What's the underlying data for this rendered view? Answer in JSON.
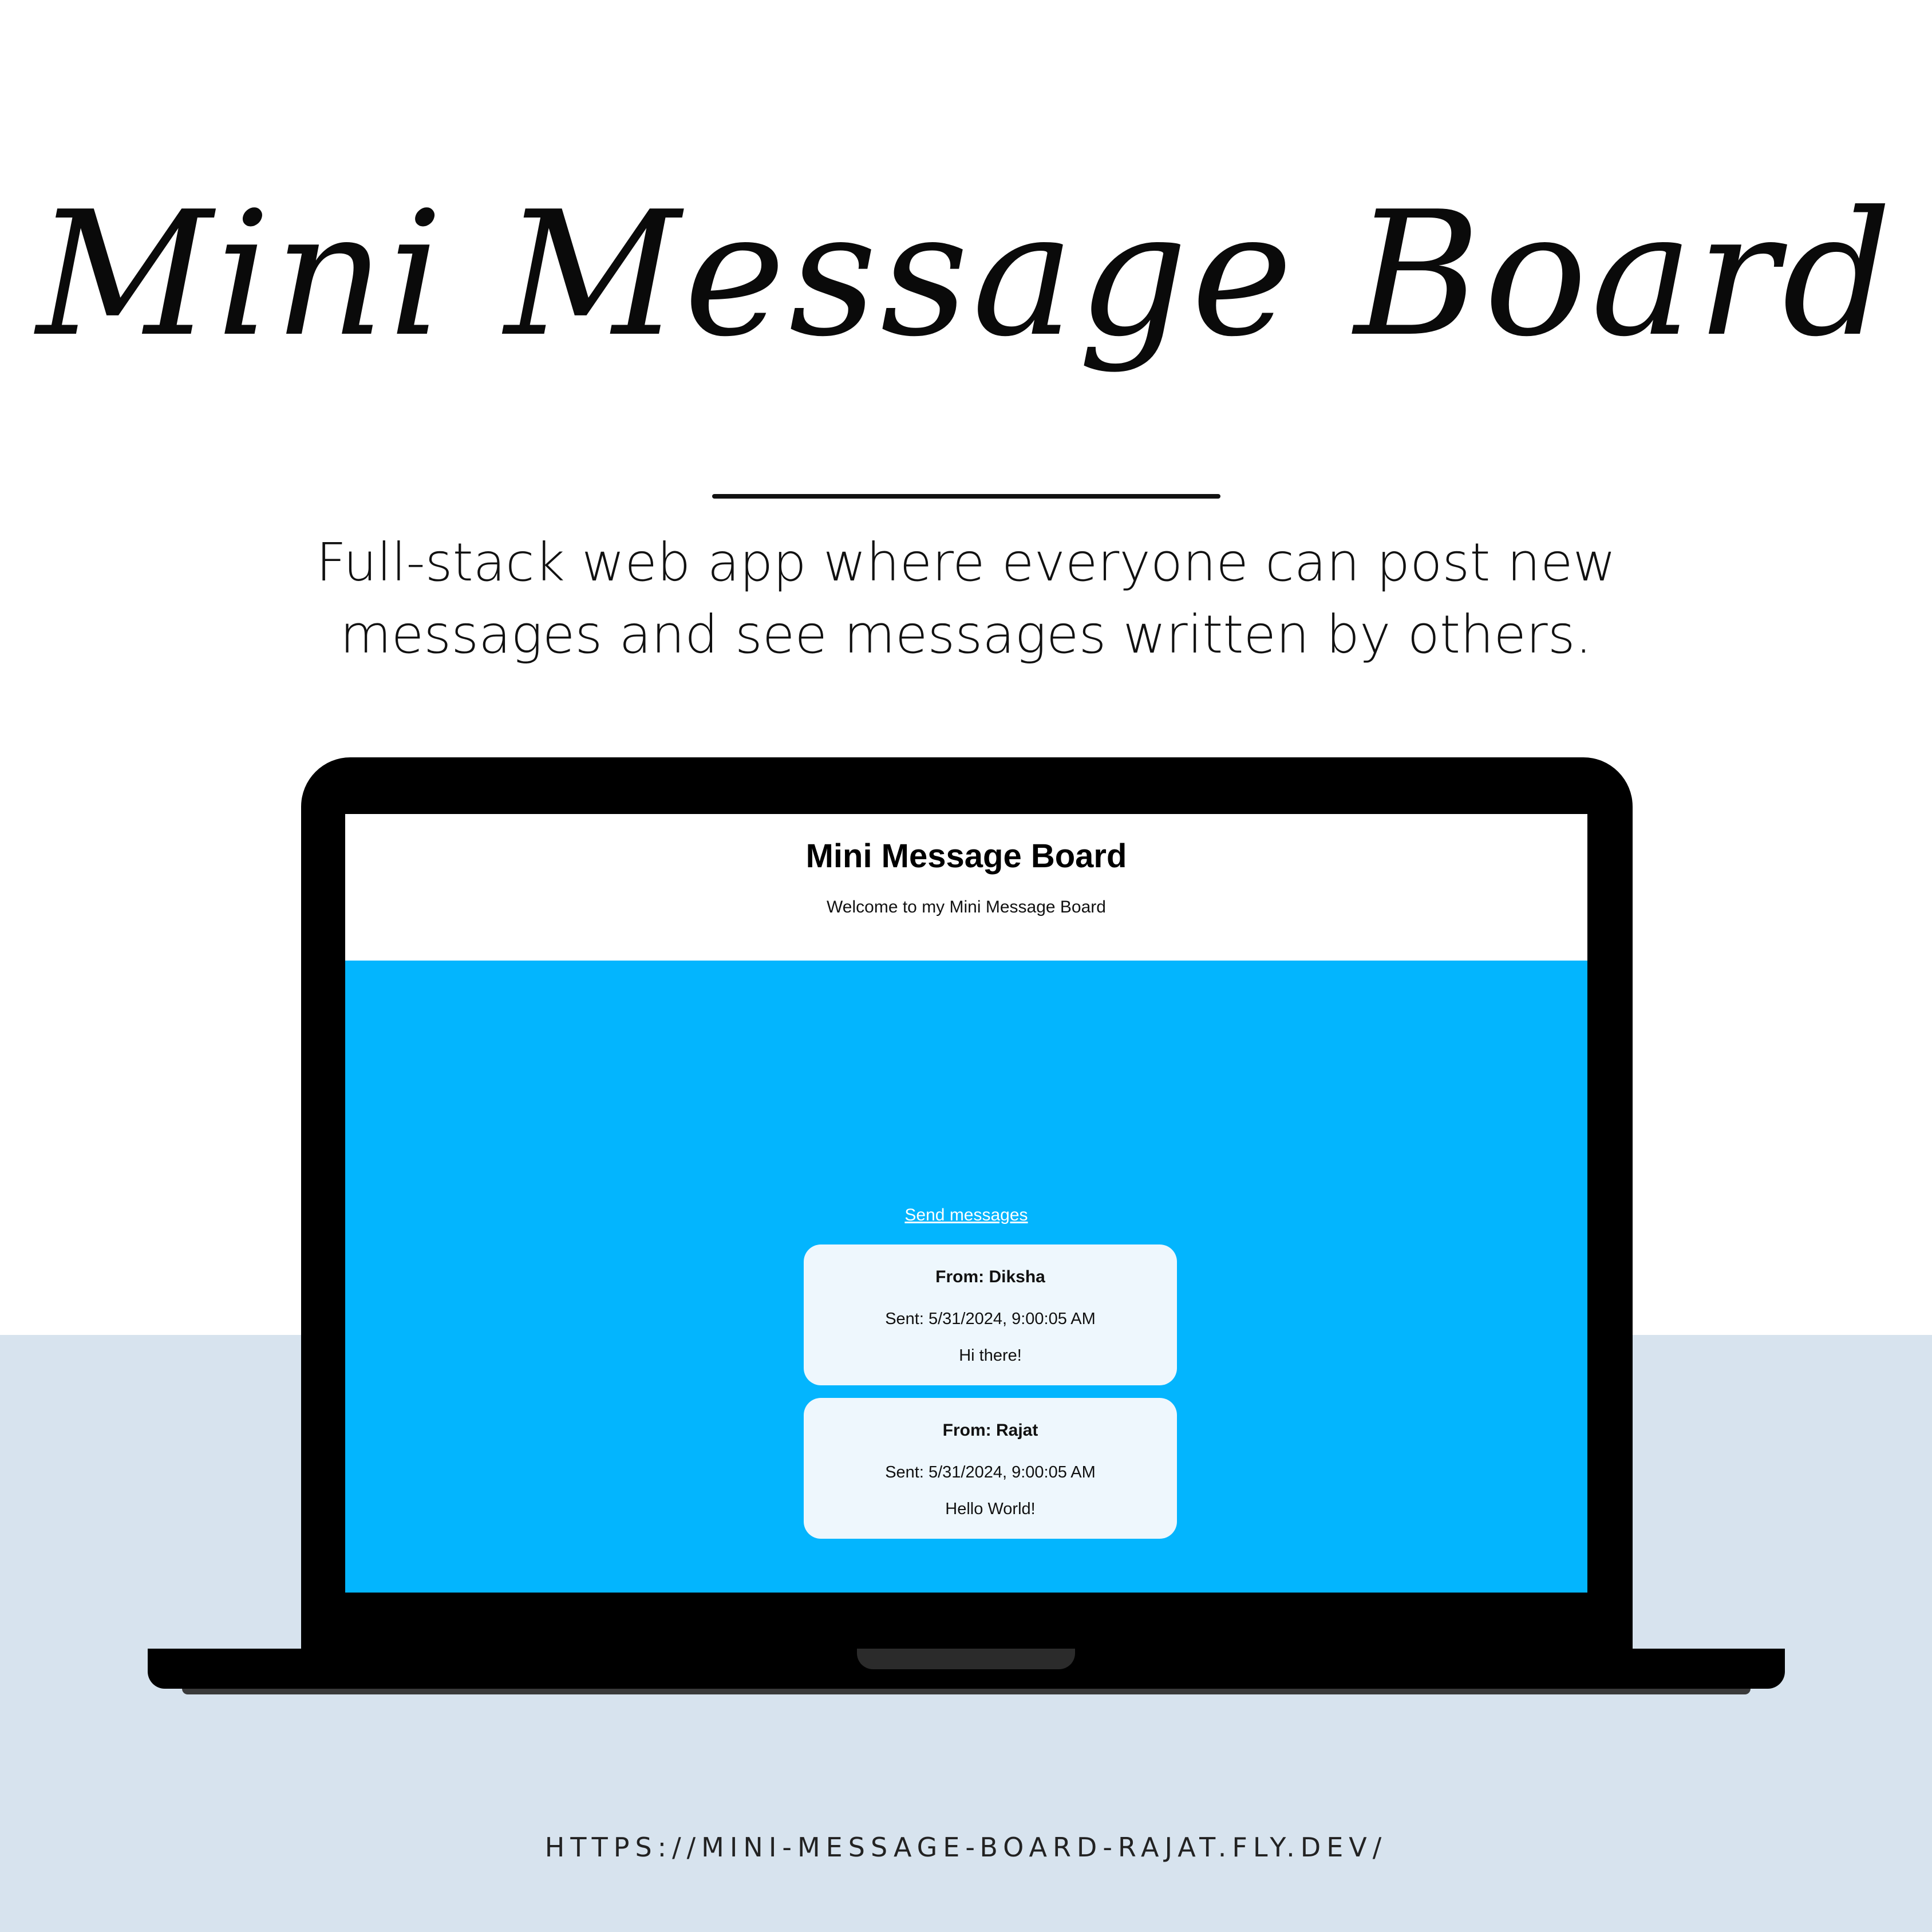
{
  "hero": {
    "title": "Mini Message Board",
    "subtitle_line1": "Full-stack web app where everyone can post new",
    "subtitle_line2": "messages and see messages written by others."
  },
  "app": {
    "title": "Mini Message Board",
    "welcome": "Welcome to my Mini Message Board",
    "send_link": "Send messages",
    "messages": [
      {
        "from": "From: Diksha",
        "sent": "Sent: 5/31/2024, 9:00:05 AM",
        "text": "Hi there!"
      },
      {
        "from": "From: Rajat",
        "sent": "Sent: 5/31/2024, 9:00:05 AM",
        "text": "Hello World!"
      }
    ]
  },
  "footer": {
    "url": "HTTPS://MINI-MESSAGE-BOARD-RAJAT.FLY.DEV/"
  },
  "colors": {
    "screen_background": "#03b5fe",
    "card_background": "#eef7fd",
    "bottom_band": "#d7e3ee",
    "laptop": "#000000"
  }
}
